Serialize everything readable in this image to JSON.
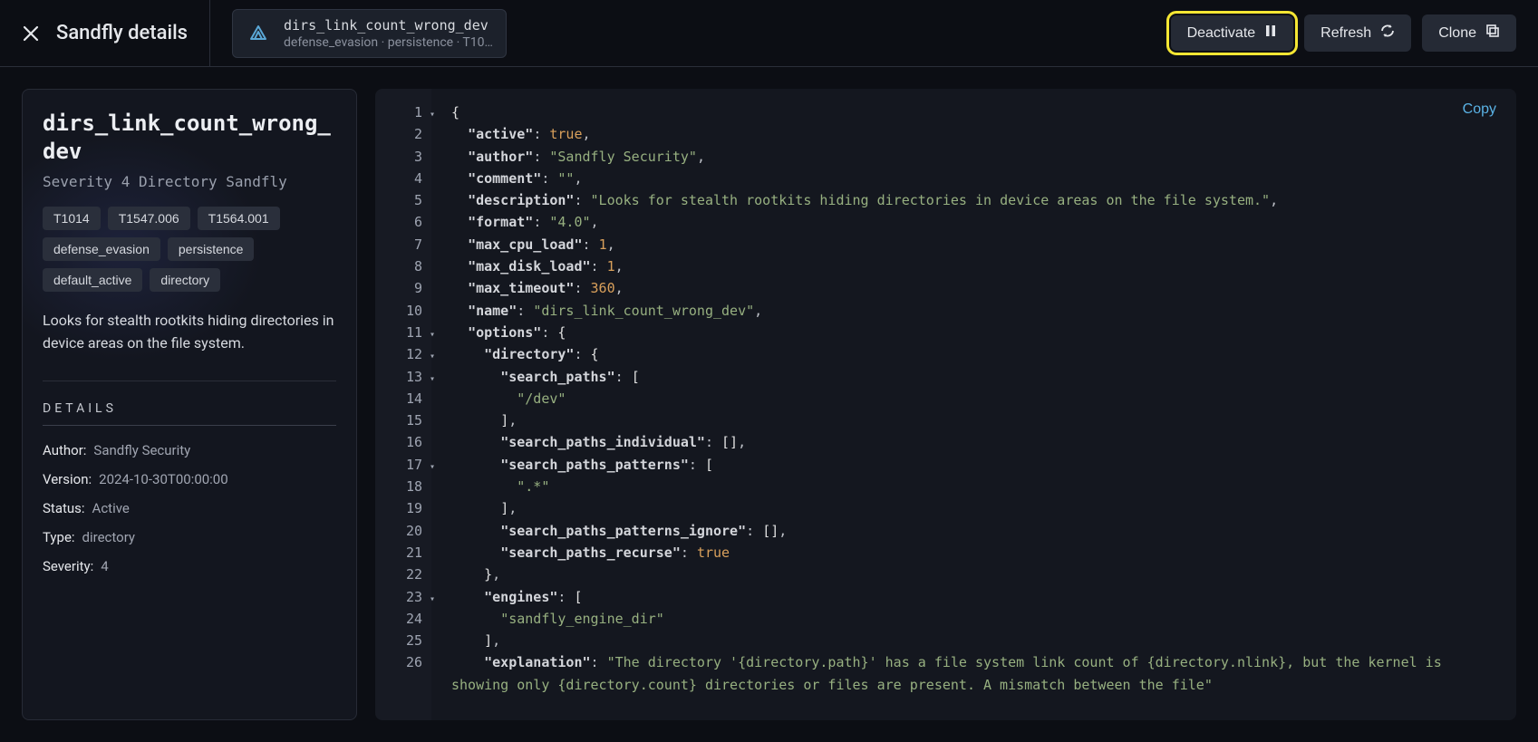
{
  "header": {
    "title": "Sandfly details",
    "chip": {
      "name": "dirs_link_count_wrong_dev",
      "subtitle": "defense_evasion · persistence · T10…"
    },
    "actions": {
      "deactivate": "Deactivate",
      "refresh": "Refresh",
      "clone": "Clone"
    }
  },
  "panel": {
    "name": "dirs_link_count_wrong_dev",
    "subtitle": "Severity 4 Directory Sandfly",
    "tags": [
      "T1014",
      "T1547.006",
      "T1564.001",
      "defense_evasion",
      "persistence",
      "default_active",
      "directory"
    ],
    "description": "Looks for stealth rootkits hiding directories in device areas on the file system.",
    "details_header": "DETAILS",
    "details": {
      "author_label": "Author:",
      "author": "Sandfly Security",
      "version_label": "Version:",
      "version": "2024-10-30T00:00:00",
      "status_label": "Status:",
      "status": "Active",
      "type_label": "Type:",
      "type": "directory",
      "severity_label": "Severity:",
      "severity": "4"
    }
  },
  "editor": {
    "copy_label": "Copy",
    "line_numbers": [
      "1",
      "2",
      "3",
      "4",
      "5",
      "6",
      "7",
      "8",
      "9",
      "10",
      "11",
      "12",
      "13",
      "14",
      "15",
      "16",
      "17",
      "18",
      "19",
      "20",
      "21",
      "22",
      "23",
      "24",
      "25",
      "26"
    ],
    "fold_lines": [
      1,
      11,
      12,
      13,
      17,
      23
    ],
    "json": {
      "active": true,
      "author": "Sandfly Security",
      "comment": "",
      "description": "Looks for stealth rootkits hiding directories in device areas on the file system.",
      "format": "4.0",
      "max_cpu_load": 1,
      "max_disk_load": 1,
      "max_timeout": 360,
      "name": "dirs_link_count_wrong_dev",
      "options": {
        "directory": {
          "search_paths": [
            "/dev"
          ],
          "search_paths_individual": [],
          "search_paths_patterns": [
            ".*"
          ],
          "search_paths_patterns_ignore": [],
          "search_paths_recurse": true
        },
        "engines": [
          "sandfly_engine_dir"
        ],
        "explanation": "The directory '{directory.path}' has a file system link count of {directory.nlink}, but the kernel is showing only {directory.count} directories or files are present. A mismatch between the file"
      }
    }
  }
}
